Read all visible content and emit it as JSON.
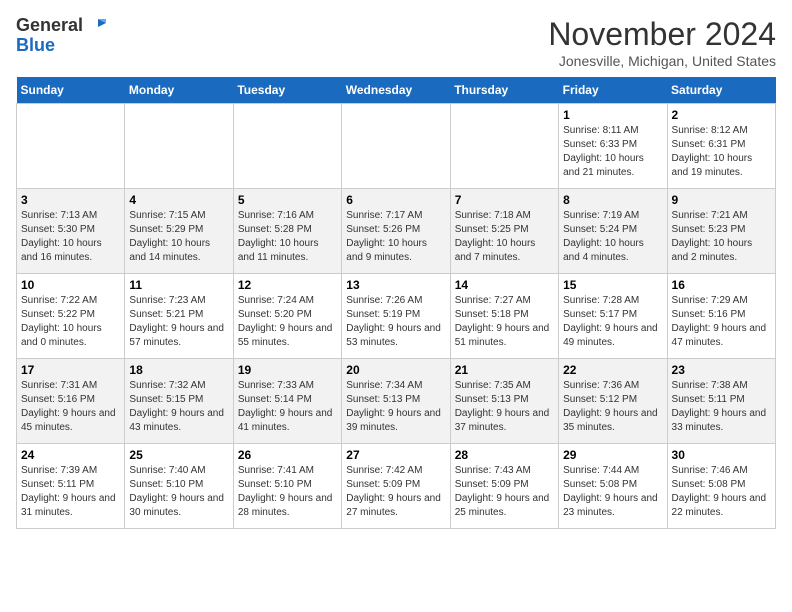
{
  "logo": {
    "text_general": "General",
    "text_blue": "Blue"
  },
  "title": {
    "month": "November 2024",
    "location": "Jonesville, Michigan, United States"
  },
  "weekdays": [
    "Sunday",
    "Monday",
    "Tuesday",
    "Wednesday",
    "Thursday",
    "Friday",
    "Saturday"
  ],
  "weeks": [
    [
      {
        "day": "",
        "info": ""
      },
      {
        "day": "",
        "info": ""
      },
      {
        "day": "",
        "info": ""
      },
      {
        "day": "",
        "info": ""
      },
      {
        "day": "",
        "info": ""
      },
      {
        "day": "1",
        "info": "Sunrise: 8:11 AM\nSunset: 6:33 PM\nDaylight: 10 hours and 21 minutes."
      },
      {
        "day": "2",
        "info": "Sunrise: 8:12 AM\nSunset: 6:31 PM\nDaylight: 10 hours and 19 minutes."
      }
    ],
    [
      {
        "day": "3",
        "info": "Sunrise: 7:13 AM\nSunset: 5:30 PM\nDaylight: 10 hours and 16 minutes."
      },
      {
        "day": "4",
        "info": "Sunrise: 7:15 AM\nSunset: 5:29 PM\nDaylight: 10 hours and 14 minutes."
      },
      {
        "day": "5",
        "info": "Sunrise: 7:16 AM\nSunset: 5:28 PM\nDaylight: 10 hours and 11 minutes."
      },
      {
        "day": "6",
        "info": "Sunrise: 7:17 AM\nSunset: 5:26 PM\nDaylight: 10 hours and 9 minutes."
      },
      {
        "day": "7",
        "info": "Sunrise: 7:18 AM\nSunset: 5:25 PM\nDaylight: 10 hours and 7 minutes."
      },
      {
        "day": "8",
        "info": "Sunrise: 7:19 AM\nSunset: 5:24 PM\nDaylight: 10 hours and 4 minutes."
      },
      {
        "day": "9",
        "info": "Sunrise: 7:21 AM\nSunset: 5:23 PM\nDaylight: 10 hours and 2 minutes."
      }
    ],
    [
      {
        "day": "10",
        "info": "Sunrise: 7:22 AM\nSunset: 5:22 PM\nDaylight: 10 hours and 0 minutes."
      },
      {
        "day": "11",
        "info": "Sunrise: 7:23 AM\nSunset: 5:21 PM\nDaylight: 9 hours and 57 minutes."
      },
      {
        "day": "12",
        "info": "Sunrise: 7:24 AM\nSunset: 5:20 PM\nDaylight: 9 hours and 55 minutes."
      },
      {
        "day": "13",
        "info": "Sunrise: 7:26 AM\nSunset: 5:19 PM\nDaylight: 9 hours and 53 minutes."
      },
      {
        "day": "14",
        "info": "Sunrise: 7:27 AM\nSunset: 5:18 PM\nDaylight: 9 hours and 51 minutes."
      },
      {
        "day": "15",
        "info": "Sunrise: 7:28 AM\nSunset: 5:17 PM\nDaylight: 9 hours and 49 minutes."
      },
      {
        "day": "16",
        "info": "Sunrise: 7:29 AM\nSunset: 5:16 PM\nDaylight: 9 hours and 47 minutes."
      }
    ],
    [
      {
        "day": "17",
        "info": "Sunrise: 7:31 AM\nSunset: 5:16 PM\nDaylight: 9 hours and 45 minutes."
      },
      {
        "day": "18",
        "info": "Sunrise: 7:32 AM\nSunset: 5:15 PM\nDaylight: 9 hours and 43 minutes."
      },
      {
        "day": "19",
        "info": "Sunrise: 7:33 AM\nSunset: 5:14 PM\nDaylight: 9 hours and 41 minutes."
      },
      {
        "day": "20",
        "info": "Sunrise: 7:34 AM\nSunset: 5:13 PM\nDaylight: 9 hours and 39 minutes."
      },
      {
        "day": "21",
        "info": "Sunrise: 7:35 AM\nSunset: 5:13 PM\nDaylight: 9 hours and 37 minutes."
      },
      {
        "day": "22",
        "info": "Sunrise: 7:36 AM\nSunset: 5:12 PM\nDaylight: 9 hours and 35 minutes."
      },
      {
        "day": "23",
        "info": "Sunrise: 7:38 AM\nSunset: 5:11 PM\nDaylight: 9 hours and 33 minutes."
      }
    ],
    [
      {
        "day": "24",
        "info": "Sunrise: 7:39 AM\nSunset: 5:11 PM\nDaylight: 9 hours and 31 minutes."
      },
      {
        "day": "25",
        "info": "Sunrise: 7:40 AM\nSunset: 5:10 PM\nDaylight: 9 hours and 30 minutes."
      },
      {
        "day": "26",
        "info": "Sunrise: 7:41 AM\nSunset: 5:10 PM\nDaylight: 9 hours and 28 minutes."
      },
      {
        "day": "27",
        "info": "Sunrise: 7:42 AM\nSunset: 5:09 PM\nDaylight: 9 hours and 27 minutes."
      },
      {
        "day": "28",
        "info": "Sunrise: 7:43 AM\nSunset: 5:09 PM\nDaylight: 9 hours and 25 minutes."
      },
      {
        "day": "29",
        "info": "Sunrise: 7:44 AM\nSunset: 5:08 PM\nDaylight: 9 hours and 23 minutes."
      },
      {
        "day": "30",
        "info": "Sunrise: 7:46 AM\nSunset: 5:08 PM\nDaylight: 9 hours and 22 minutes."
      }
    ]
  ]
}
